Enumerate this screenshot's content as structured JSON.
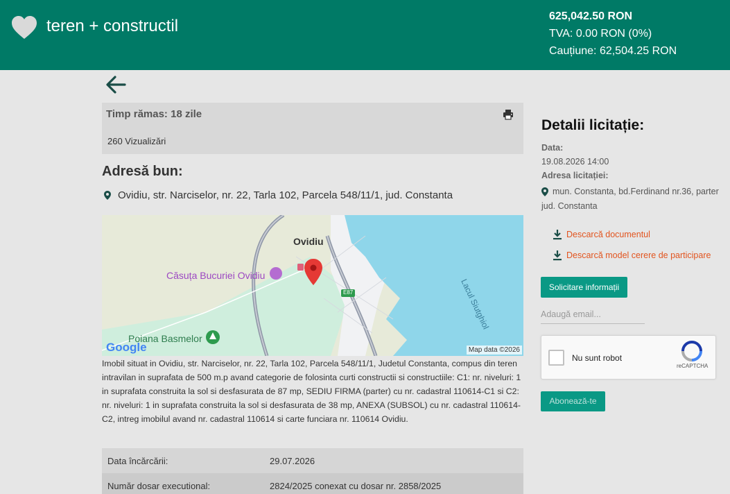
{
  "header": {
    "title": "teren + constructil",
    "price": "625,042.50 RON",
    "tva": "TVA: 0.00 RON (0%)",
    "cautiune": "Cauțiune: 62,504.25 RON"
  },
  "info": {
    "time_label": "Timp rămas:",
    "time_value": "18 zile",
    "views": "260 Vizualizări"
  },
  "address": {
    "title": "Adresă bun:",
    "line": "Ovidiu, str. Narciselor, nr. 22, Tarla 102, Parcela 548/11/1, jud. Constanta"
  },
  "map": {
    "labels": {
      "town": "Ovidiu",
      "place1": "Căsuța Bucuriei Ovidiu",
      "place2": "Poiana Basmelor",
      "lake": "Lacul Siutghiol",
      "road": "E87",
      "google": "Google"
    },
    "attribution": "Map data ©2026"
  },
  "description": "Imobil situat in Ovidiu, str. Narciselor, nr. 22, Tarla 102, Parcela 548/11/1, Judetul Constanta, compus din teren intravilan in suprafata de 500 m.p avand categorie de folosinta curti constructii si constructiile: C1: nr. niveluri: 1 in suprafata construita la sol si desfasurata de 87 mp, SEDIU FIRMA (parter) cu nr. cadastral 110614-C1 si C2: nr. niveluri: 1 in suprafata construita la sol si desfasurata de 38 mp, ANEXA (SUBSOL) cu nr. cadastral 110614-C2, intreg imobilul avand nr. cadastral 110614 si carte funciara nr. 110614 Ovidiu.",
  "details": [
    {
      "key": "Data încărcării:",
      "value": "29.07.2026"
    },
    {
      "key": "Număr dosar executional:",
      "value": "2824/2025 conexat cu dosar nr. 2858/2025"
    }
  ],
  "sidebar": {
    "title": "Detalii licitație:",
    "date_label": "Data:",
    "date_value": "19.08.2026 14:00",
    "addr_label": "Adresa licitației:",
    "addr_line1": "mun. Constanta, bd.Ferdinand nr.36, parter",
    "addr_line2": "jud. Constanta",
    "download_doc": "Descarcă documentul",
    "download_model": "Descarcă model cerere de participare",
    "request_info": "Solicitare informații",
    "email_placeholder": "Adaugă email...",
    "captcha_label": "Nu sunt robot",
    "captcha_brand": "reCAPTCHA",
    "subscribe": "Abonează-te"
  },
  "colors": {
    "header_bg": "#007a66",
    "button": "#0a9985",
    "link": "#e2541f"
  }
}
